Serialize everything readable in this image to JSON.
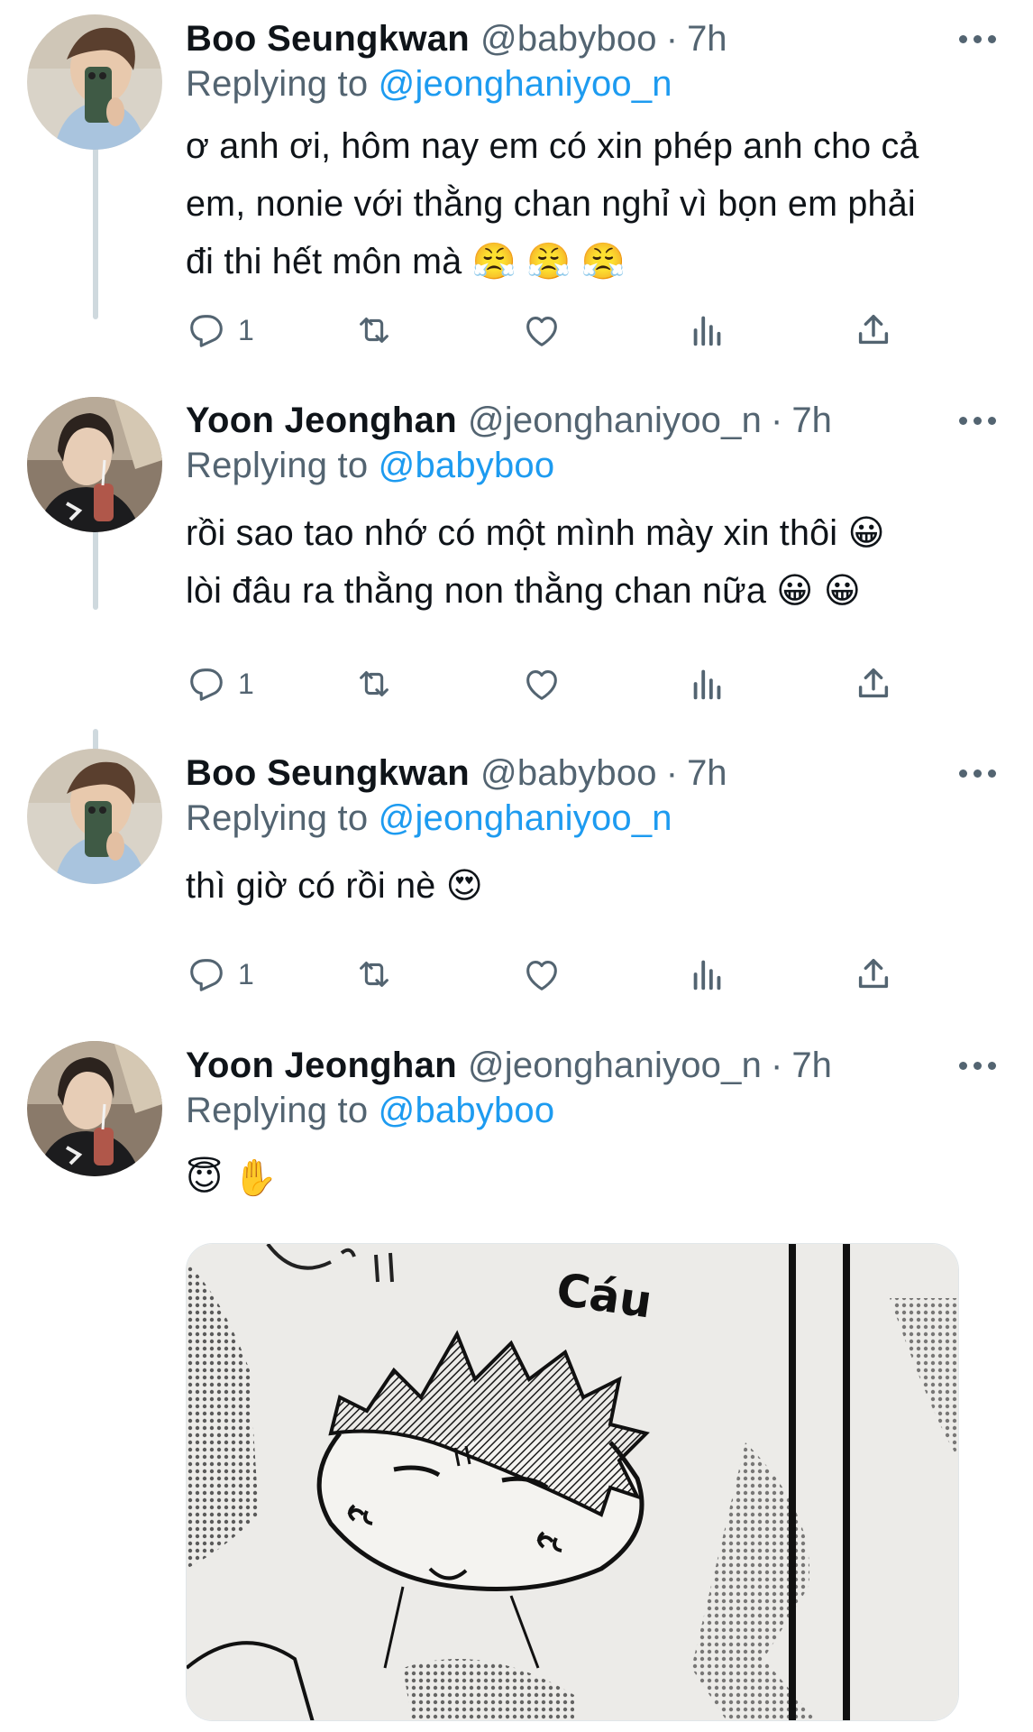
{
  "thread": [
    {
      "name": "Boo Seungkwan",
      "handle": "@babyboo",
      "time": "7h",
      "replying_prefix": "Replying to ",
      "replying_to": "@jeonghaniyoo_n",
      "text": "ơ anh ơi, hôm nay em có xin phép anh cho cả\nem, nonie với thằng chan nghỉ vì bọn em phải\nđi thi hết môn mà 😤 😤 😤",
      "reply_count": "1",
      "avatar": "boo-avatar"
    },
    {
      "name": "Yoon Jeonghan",
      "handle": "@jeonghaniyoo_n",
      "time": "7h",
      "replying_prefix": "Replying to ",
      "replying_to": "@babyboo",
      "text": "rồi sao tao nhớ có một mình mày xin thôi 😀\nlòi đâu ra thằng non thằng chan nữa 😀 😀",
      "reply_count": "1",
      "avatar": "jeonghan-avatar"
    },
    {
      "name": "Boo Seungkwan",
      "handle": "@babyboo",
      "time": "7h",
      "replying_prefix": "Replying to ",
      "replying_to": "@jeonghaniyoo_n",
      "text": "thì giờ có rồi nè 😍",
      "reply_count": "1",
      "avatar": "boo-avatar"
    },
    {
      "name": "Yoon Jeonghan",
      "handle": "@jeonghaniyoo_n",
      "time": "7h",
      "replying_prefix": "Replying to ",
      "replying_to": "@babyboo",
      "text": "😇 ✋",
      "avatar": "jeonghan-avatar",
      "media": {
        "kind": "manga-panel",
        "caption_text": "Cáu"
      }
    }
  ],
  "separator": "·",
  "icons": [
    "reply-icon",
    "retweet-icon",
    "like-icon",
    "views-icon",
    "share-icon",
    "more-icon"
  ],
  "colors": {
    "text": "#0f1419",
    "secondary": "#536471",
    "link": "#1d9bf0",
    "thread_line": "#cfd9de"
  }
}
